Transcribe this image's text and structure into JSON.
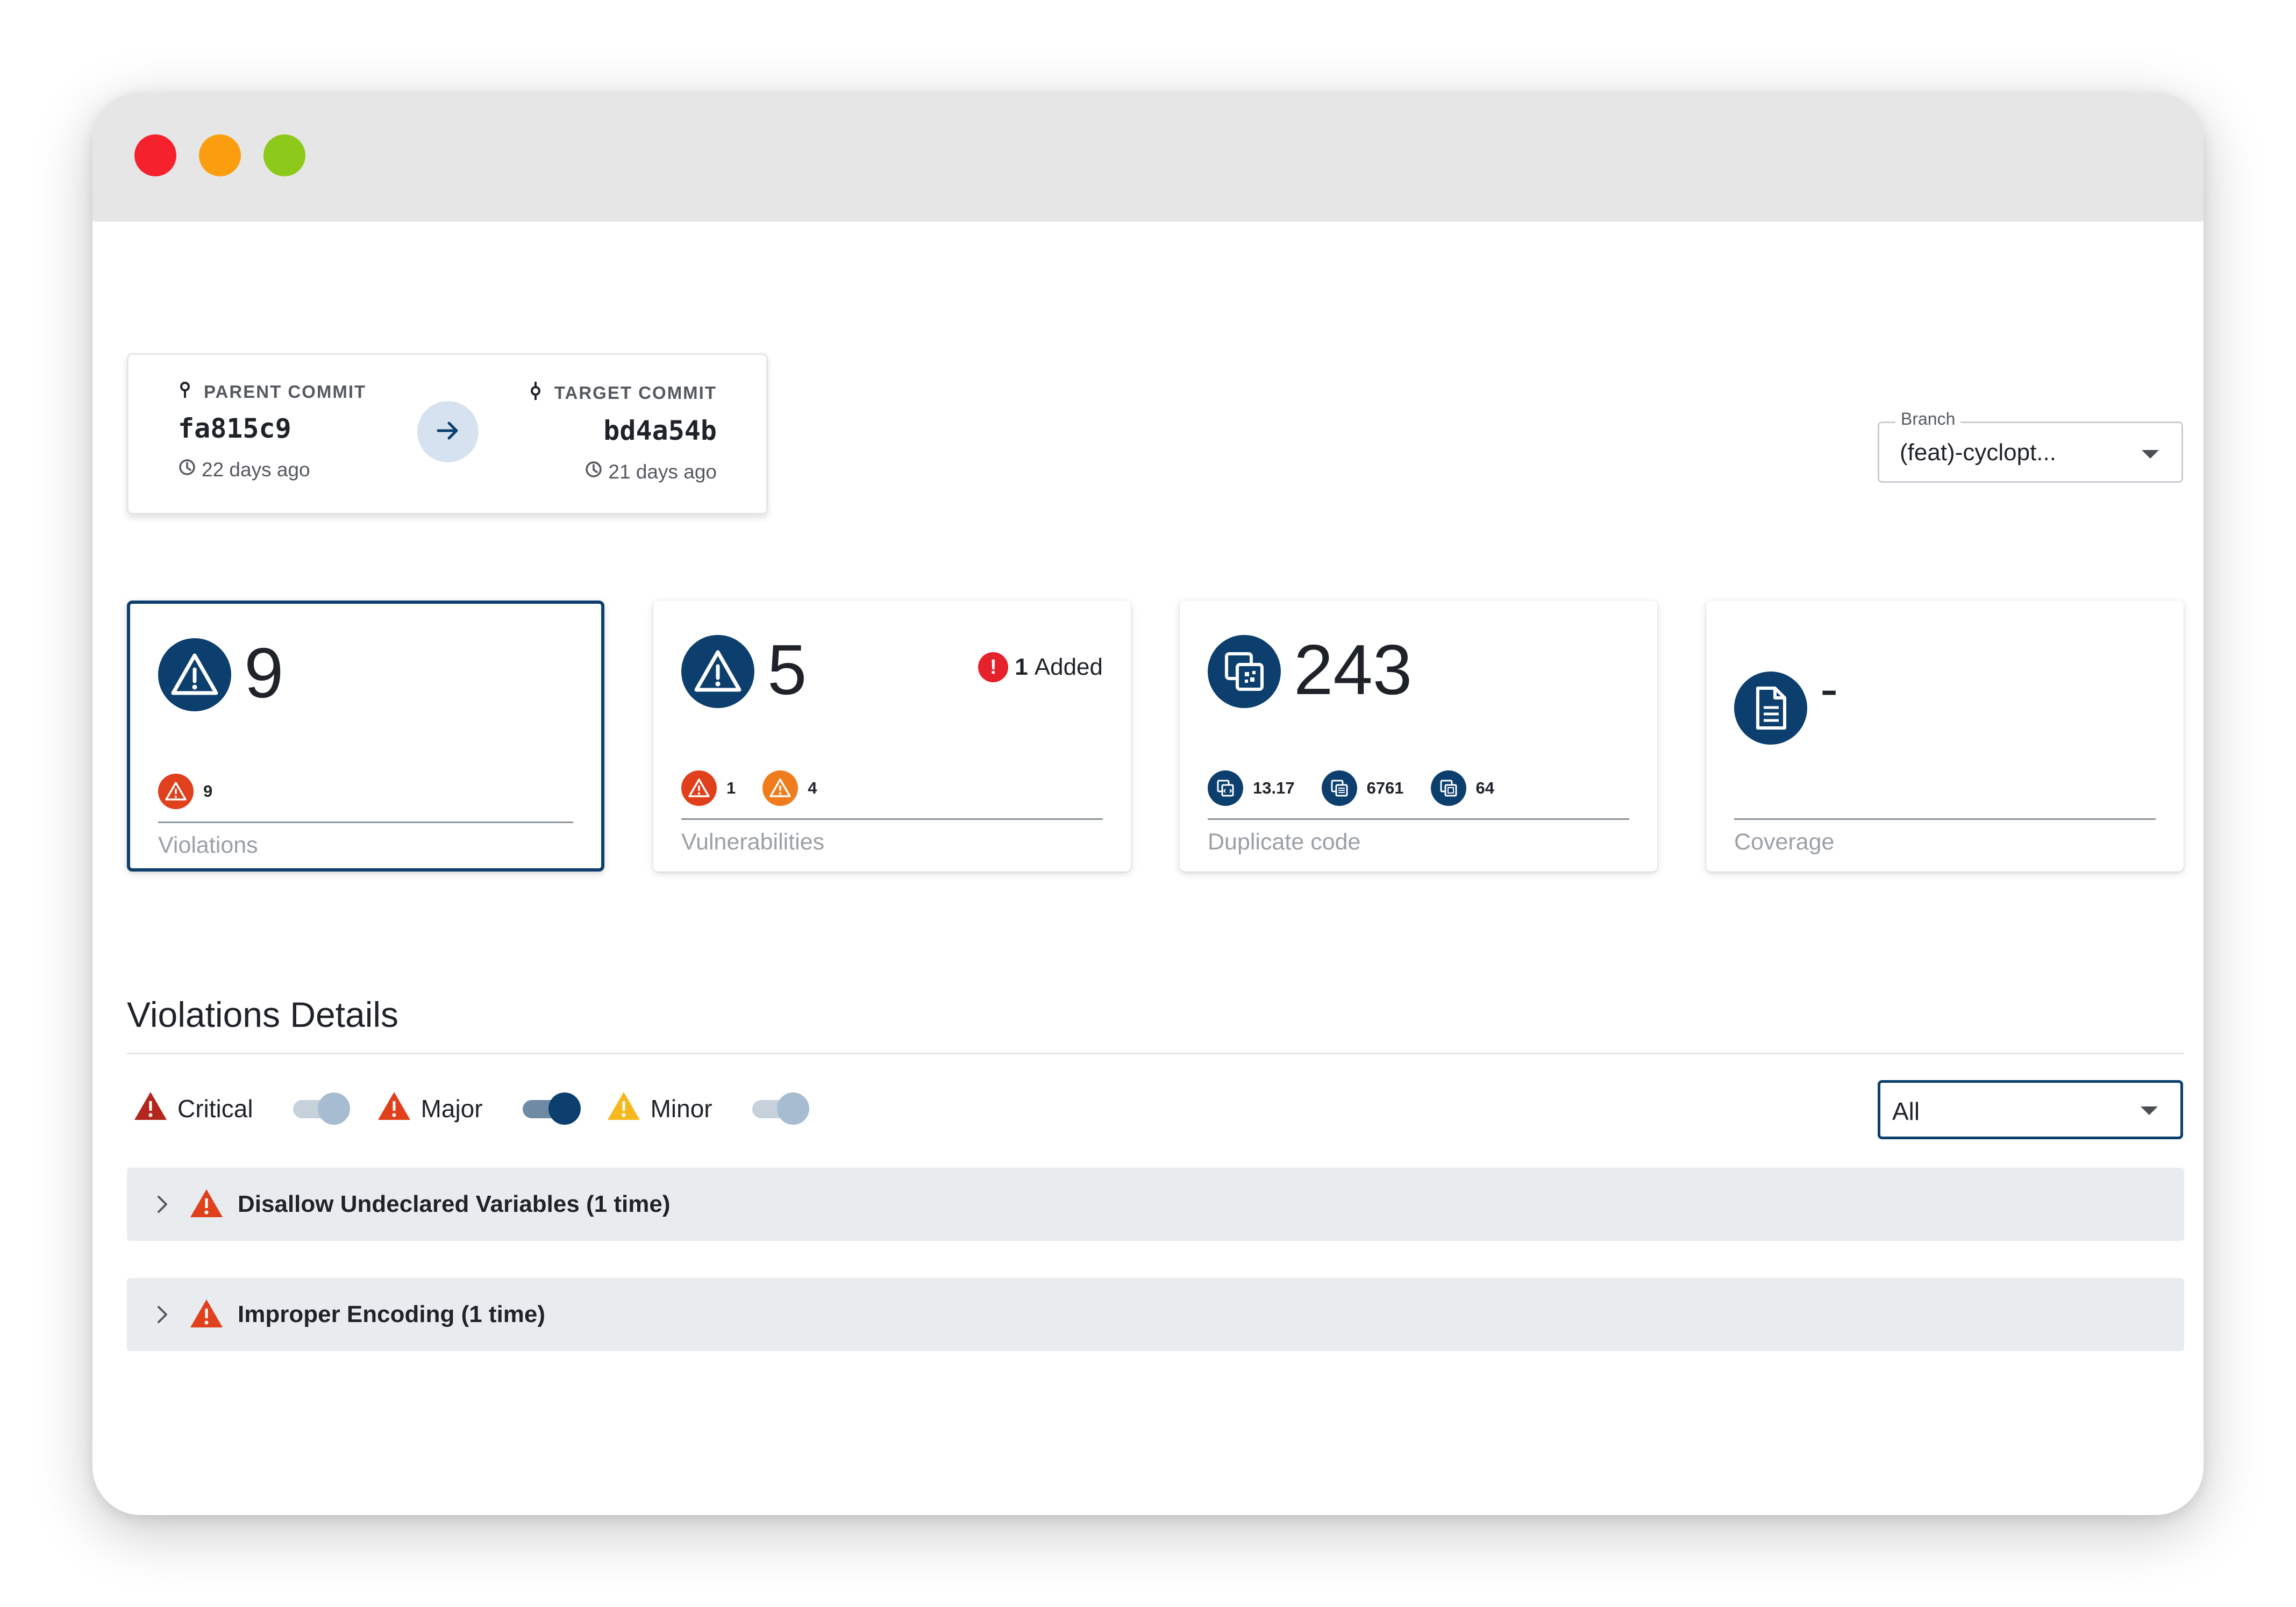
{
  "window": {
    "controls": [
      "close",
      "minimize",
      "maximize"
    ]
  },
  "commits": {
    "parent": {
      "label": "PARENT COMMIT",
      "hash": "fa815c9",
      "time": "22 days ago"
    },
    "target": {
      "label": "TARGET COMMIT",
      "hash": "bd4a54b",
      "time": "21 days ago"
    }
  },
  "branch": {
    "legend": "Branch",
    "value": "(feat)-cyclopt..."
  },
  "stats": {
    "violations": {
      "value": "9",
      "label": "Violations",
      "critical_count": "9"
    },
    "vulnerabilities": {
      "value": "5",
      "label": "Vulnerabilities",
      "critical_count": "1",
      "major_count": "4",
      "added_count": "1",
      "added_label": "Added"
    },
    "duplicate": {
      "value": "243",
      "label": "Duplicate code",
      "metric1": "13.17",
      "metric2": "6761",
      "metric3": "64"
    },
    "coverage": {
      "value": "-",
      "label": "Coverage"
    }
  },
  "details": {
    "title": "Violations Details",
    "filters": [
      {
        "label": "Critical",
        "color": "#b3261e",
        "enabled": false
      },
      {
        "label": "Major",
        "color": "#e0401b",
        "enabled": true
      },
      {
        "label": "Minor",
        "color": "#f5b91e",
        "enabled": false
      }
    ],
    "severity_select": "All",
    "rules": [
      {
        "label": "Disallow Undeclared Variables (1 time)",
        "severity": "Major"
      },
      {
        "label": "Improper Encoding (1 time)",
        "severity": "Major"
      }
    ]
  },
  "colors": {
    "accent": "#0c3f6e",
    "critical": "#b3261e",
    "major": "#e0401b",
    "minor": "#f5b91e",
    "alert": "#e5212b"
  }
}
